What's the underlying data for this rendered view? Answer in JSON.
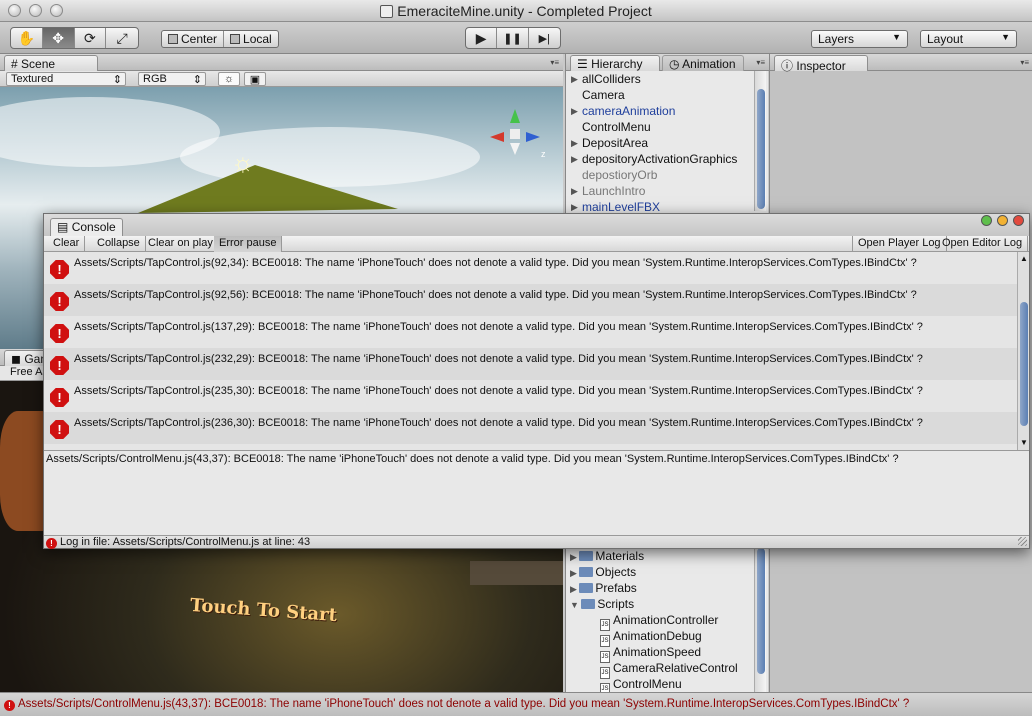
{
  "window": {
    "title": "EmeraciteMine.unity - Completed Project"
  },
  "toolbar": {
    "tools": [
      {
        "icon": "hand-icon",
        "glyph": "✋"
      },
      {
        "icon": "move-icon",
        "glyph": "✥"
      },
      {
        "icon": "rotate-icon",
        "glyph": "⟳"
      },
      {
        "icon": "scale-icon",
        "glyph": "⤢"
      }
    ],
    "pivot_label": "Center",
    "space_label": "Local",
    "play_glyph": "▶",
    "pause_glyph": "❚❚",
    "step_glyph": "▶|",
    "layers_label": "Layers",
    "layout_label": "Layout"
  },
  "scene": {
    "tab_label": "Scene",
    "render_mode": "Textured",
    "channel": "RGB",
    "gizmo_axis_label": "z"
  },
  "game": {
    "tab_label": "Game",
    "aspect_label": "Free Aspect",
    "overlay_text": "Touch To Start"
  },
  "hierarchy": {
    "tab_label": "Hierarchy",
    "animation_tab_label": "Animation",
    "items": [
      {
        "label": "allColliders",
        "expandable": true,
        "color": "#111111"
      },
      {
        "label": "Camera",
        "expandable": false,
        "color": "#111111"
      },
      {
        "label": "cameraAnimation",
        "expandable": true,
        "color": "#1f3f9c"
      },
      {
        "label": "ControlMenu",
        "expandable": false,
        "color": "#111111"
      },
      {
        "label": "DepositArea",
        "expandable": true,
        "color": "#111111"
      },
      {
        "label": "depositoryActivationGraphics",
        "expandable": true,
        "color": "#111111"
      },
      {
        "label": "depostioryOrb",
        "expandable": false,
        "color": "#777777"
      },
      {
        "label": "LaunchIntro",
        "expandable": true,
        "color": "#777777"
      },
      {
        "label": "mainLevelFBX",
        "expandable": true,
        "color": "#1f3f9c"
      }
    ]
  },
  "project": {
    "items": [
      {
        "label": "Materials",
        "type": "folder",
        "expanded": false,
        "indent": 0
      },
      {
        "label": "Objects",
        "type": "folder",
        "expanded": false,
        "indent": 0
      },
      {
        "label": "Prefabs",
        "type": "folder",
        "expanded": false,
        "indent": 0
      },
      {
        "label": "Scripts",
        "type": "folder",
        "expanded": true,
        "indent": 0
      },
      {
        "label": "AnimationController",
        "type": "js",
        "indent": 1
      },
      {
        "label": "AnimationDebug",
        "type": "js",
        "indent": 1
      },
      {
        "label": "AnimationSpeed",
        "type": "js",
        "indent": 1
      },
      {
        "label": "CameraRelativeControl",
        "type": "js",
        "indent": 1
      },
      {
        "label": "ControlMenu",
        "type": "js",
        "indent": 1
      }
    ]
  },
  "inspector": {
    "tab_label": "Inspector"
  },
  "console": {
    "tab_label": "Console",
    "buttons": {
      "clear": "Clear",
      "collapse": "Collapse",
      "clear_on_play": "Clear on play",
      "error_pause": "Error pause",
      "open_player_log": "Open Player Log",
      "open_editor_log": "Open Editor Log"
    },
    "entries": [
      "Assets/Scripts/TapControl.js(92,34): BCE0018: The name 'iPhoneTouch' does not denote a valid type. Did you mean 'System.Runtime.InteropServices.ComTypes.IBindCtx' ?",
      "Assets/Scripts/TapControl.js(92,56): BCE0018: The name 'iPhoneTouch' does not denote a valid type. Did you mean 'System.Runtime.InteropServices.ComTypes.IBindCtx' ?",
      "Assets/Scripts/TapControl.js(137,29): BCE0018: The name 'iPhoneTouch' does not denote a valid type. Did you mean 'System.Runtime.InteropServices.ComTypes.IBindCtx' ?",
      "Assets/Scripts/TapControl.js(232,29): BCE0018: The name 'iPhoneTouch' does not denote a valid type. Did you mean 'System.Runtime.InteropServices.ComTypes.IBindCtx' ?",
      "Assets/Scripts/TapControl.js(235,30): BCE0018: The name 'iPhoneTouch' does not denote a valid type. Did you mean 'System.Runtime.InteropServices.ComTypes.IBindCtx' ?",
      "Assets/Scripts/TapControl.js(236,30): BCE0018: The name 'iPhoneTouch' does not denote a valid type. Did you mean 'System.Runtime.InteropServices.ComTypes.IBindCtx' ?"
    ],
    "detail": "Assets/Scripts/ControlMenu.js(43,37): BCE0018: The name 'iPhoneTouch' does not denote a valid type. Did you mean 'System.Runtime.InteropServices.ComTypes.IBindCtx' ?",
    "log_status": "Log in file: Assets/Scripts/ControlMenu.js at line: 43"
  },
  "statusbar": {
    "message": "Assets/Scripts/ControlMenu.js(43,37): BCE0018: The name 'iPhoneTouch' does not denote a valid type. Did you mean 'System.Runtime.InteropServices.ComTypes.IBindCtx' ?"
  },
  "colors": {
    "error_red": "#d01010",
    "prefab_blue": "#1f3f9c",
    "status_text": "#8c0000"
  }
}
